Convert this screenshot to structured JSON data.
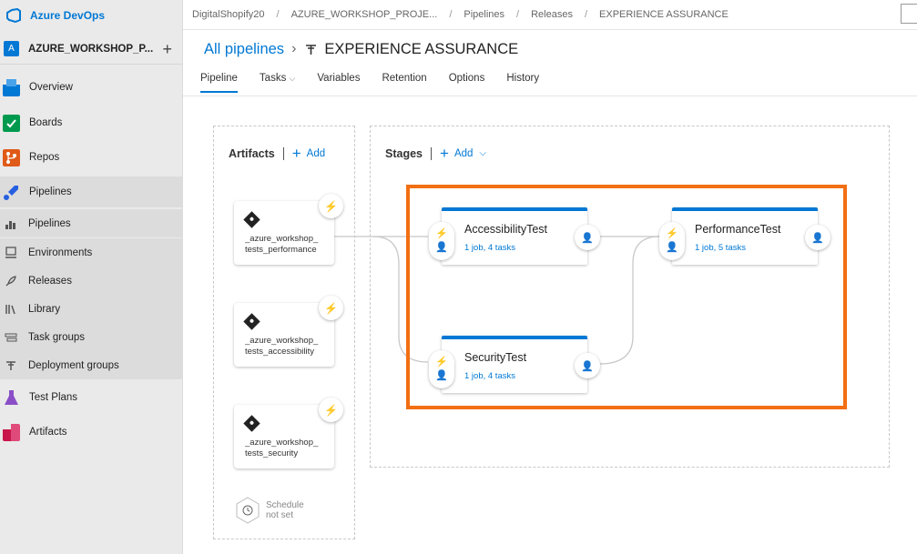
{
  "brand": {
    "name": "Azure DevOps"
  },
  "project": {
    "avatar": "A",
    "name": "AZURE_WORKSHOP_P...",
    "add": "+"
  },
  "sidebar": {
    "items": [
      {
        "label": "Overview",
        "icon": "overview-icon",
        "color": "#0078d4"
      },
      {
        "label": "Boards",
        "icon": "boards-icon",
        "color": "#009a4e"
      },
      {
        "label": "Repos",
        "icon": "repos-icon",
        "color": "#e05a18"
      },
      {
        "label": "Pipelines",
        "icon": "pipelines-icon",
        "color": "#2560e0"
      }
    ],
    "pipeline_subitems": [
      {
        "label": "Pipelines",
        "icon": "pipelines-sub-icon"
      },
      {
        "label": "Environments",
        "icon": "environments-icon"
      },
      {
        "label": "Releases",
        "icon": "releases-icon"
      },
      {
        "label": "Library",
        "icon": "library-icon"
      },
      {
        "label": "Task groups",
        "icon": "task-groups-icon"
      },
      {
        "label": "Deployment groups",
        "icon": "deployment-groups-icon"
      }
    ],
    "bottom_items": [
      {
        "label": "Test Plans",
        "icon": "test-plans-icon",
        "color": "#8a4fc7"
      },
      {
        "label": "Artifacts",
        "icon": "artifacts-icon",
        "color": "#c8174a"
      }
    ]
  },
  "breadcrumb": [
    "DigitalShopify20",
    "AZURE_WORKSHOP_PROJE...",
    "Pipelines",
    "Releases",
    "EXPERIENCE ASSURANCE"
  ],
  "header": {
    "all_pipelines": "All pipelines",
    "title": "EXPERIENCE ASSURANCE"
  },
  "tabs": [
    {
      "label": "Pipeline",
      "active": true
    },
    {
      "label": "Tasks",
      "dropdown": true
    },
    {
      "label": "Variables"
    },
    {
      "label": "Retention"
    },
    {
      "label": "Options"
    },
    {
      "label": "History"
    }
  ],
  "artifacts": {
    "heading": "Artifacts",
    "add_label": "Add",
    "cards": [
      {
        "name_line1": "_azure_workshop_",
        "name_line2": "tests_performance"
      },
      {
        "name_line1": "_azure_workshop_",
        "name_line2": "tests_accessibility"
      },
      {
        "name_line1": "_azure_workshop_",
        "name_line2": "tests_security"
      }
    ],
    "schedule_line1": "Schedule",
    "schedule_line2": "not set"
  },
  "stages": {
    "heading": "Stages",
    "add_label": "Add",
    "items": [
      {
        "name": "AccessibilityTest",
        "summary": "1 job, 4 tasks"
      },
      {
        "name": "PerformanceTest",
        "summary": "1 job, 5 tasks"
      },
      {
        "name": "SecurityTest",
        "summary": "1 job, 4 tasks"
      }
    ]
  },
  "colors": {
    "accent": "#0078d4",
    "highlight": "#f26f13"
  }
}
